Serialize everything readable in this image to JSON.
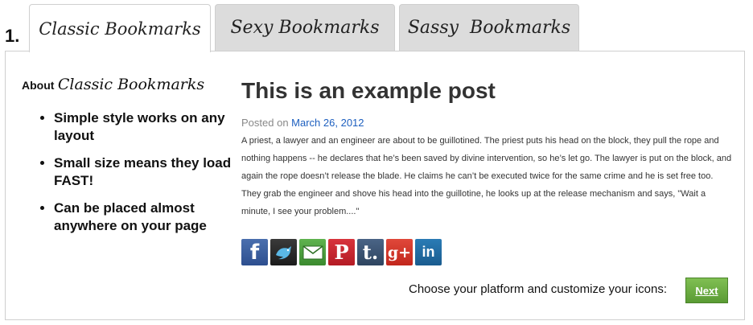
{
  "step_number": "1.",
  "tabs": [
    {
      "label": "Classic Bookmarks",
      "active": true
    },
    {
      "label": "Sexy Bookmarks",
      "active": false
    },
    {
      "label": "Sassy  Bookmarks",
      "active": false
    }
  ],
  "about": {
    "prefix": "About",
    "name": "Classic Bookmarks",
    "features": [
      "Simple style works on any layout",
      "Small size means they load FAST!",
      "Can be placed almost anywhere on your page"
    ]
  },
  "post": {
    "title": "This is an example post",
    "posted_label": "Posted on",
    "date": "March 26, 2012",
    "body": "A priest, a lawyer and an engineer are about to be guillotined. The priest puts his head on the block, they pull the rope and nothing happens -- he declares that he’s been saved by divine intervention, so he’s let go. The lawyer is put on the block, and again the rope doesn’t release the blade. He claims he can’t be executed twice for the same crime and he is set free too. They grab the engineer and shove his head into the guillotine, he looks up at the release mechanism and says, \"Wait a minute, I see your problem....\""
  },
  "share_icons": [
    {
      "name": "facebook-icon",
      "glyph": "f"
    },
    {
      "name": "twitter-icon",
      "glyph": ""
    },
    {
      "name": "email-icon",
      "glyph": ""
    },
    {
      "name": "pinterest-icon",
      "glyph": "P"
    },
    {
      "name": "tumblr-icon",
      "glyph": "t."
    },
    {
      "name": "google-plus-icon",
      "glyph": "g+"
    },
    {
      "name": "linkedin-icon",
      "glyph": "in"
    }
  ],
  "footer": {
    "cta_text": "Choose your platform and customize your icons:",
    "next_label": "Next"
  },
  "colors": {
    "link_blue": "#1d5fbf",
    "next_green": "#6aaa3e",
    "tab_inactive": "#dcdcdc"
  }
}
